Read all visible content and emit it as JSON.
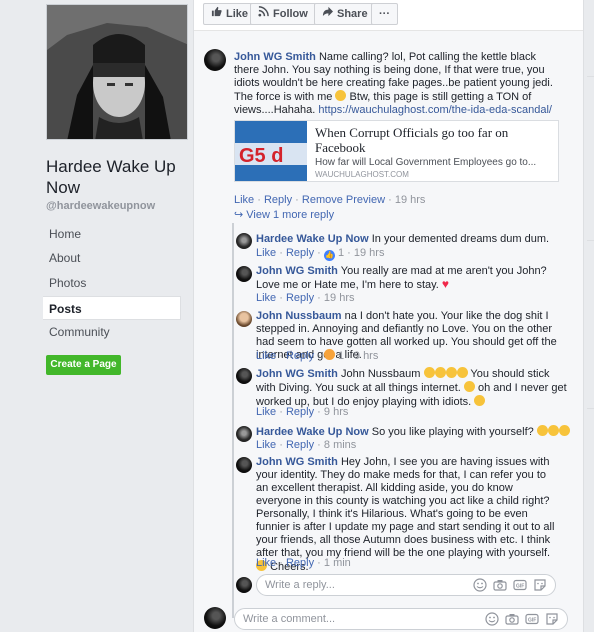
{
  "sidebar": {
    "page_name": "Hardee Wake Up Now",
    "handle": "@hardeewakeupnow",
    "nav": [
      "Home",
      "About",
      "Photos",
      "Posts",
      "Community"
    ],
    "active": "Posts",
    "create_page": "Create a Page"
  },
  "toolbar": {
    "like": "Like",
    "follow": "Follow",
    "share": "Share",
    "more": "···"
  },
  "comment_main": {
    "author": "John WG Smith",
    "text": "Name calling? lol, Pot calling the kettle black there John. You say nothing is being done, If that were true, you idiots wouldn't be here creating fake pages..be patient young jedi. The force is with me",
    "text2": "Btw, this page is still getting a TON of views....Hahaha.",
    "link": "https://wauchulaghost.com/the-ida-eda-scandal/",
    "actions": [
      "Like",
      "Reply",
      "Remove Preview"
    ],
    "time": "19 hrs",
    "view_more": "View 1 more reply"
  },
  "preview": {
    "title": "When Corrupt Officials go too far on Facebook",
    "desc": "How far will Local Government Employees go to...",
    "domain": "WAUCHULAGHOST.COM",
    "img_text": "G5 d"
  },
  "replies": [
    {
      "author": "Hardee Wake Up Now",
      "text": "In your demented dreams dum dum.",
      "reaction_count": "1",
      "time": "19 hrs"
    },
    {
      "author": "John WG Smith",
      "text": "You really are mad at me aren't you John? Love me or Hate me, I'm here to stay.",
      "time": "19 hrs"
    },
    {
      "author": "John Nussbaum",
      "text": "na I don't hate you. Your like the dog shit I stepped in. Annoying and defiantly no Love. You on the other had seem to have gotten all worked up. You should get off the internet and get a life.",
      "reaction_count": "1",
      "time": "9 hrs"
    },
    {
      "author": "John WG Smith",
      "text_a": "John Nussbaum",
      "text_b": "You should stick with Diving. You suck at all things internet.",
      "text_c": "oh and I never get worked up, but I do enjoy playing with idiots.",
      "time": "9 hrs"
    },
    {
      "author": "Hardee Wake Up Now",
      "text": "So you like playing with yourself?",
      "time": "8 mins"
    },
    {
      "author": "John WG Smith",
      "text": "Hey John, I see you are having issues with your identity. They do make meds for that, I can refer you to an excellent therapist. All kidding aside, you do know everyone in this county is watching you act like a child right? Personally, I think it's Hilarious. What's going to be even funnier is after I update my page and start sending it out to all your friends, all those Autumn does business with etc. I think after that, you my friend will be the one playing with yourself.",
      "text_end": "Cheers.",
      "time": "1 min"
    }
  ],
  "labels": {
    "like": "Like",
    "reply": "Reply",
    "dot": "·"
  },
  "reply_input": {
    "placeholder": "Write a reply..."
  },
  "comment_input": {
    "placeholder": "Write a comment..."
  },
  "colors": {
    "link": "#365899",
    "create_button": "#42b72a",
    "background": "#e9ebee"
  }
}
